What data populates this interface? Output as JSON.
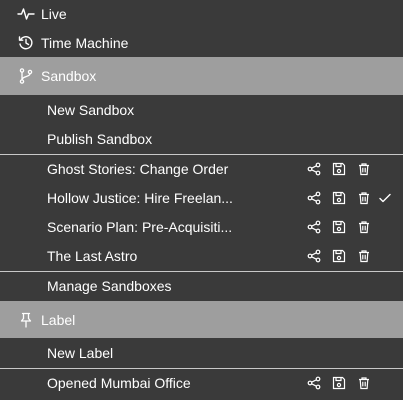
{
  "menu": {
    "top_items": [
      {
        "label": "Live",
        "icon": "pulse-icon"
      },
      {
        "label": "Time Machine",
        "icon": "history-icon"
      }
    ],
    "sandbox": {
      "header": "Sandbox",
      "icon": "git-branch-icon",
      "actions": [
        "New Sandbox",
        "Publish Sandbox"
      ],
      "items": [
        {
          "label": "Ghost Stories: Change Order",
          "active": false
        },
        {
          "label": "Hollow Justice: Hire Freelan...",
          "active": true
        },
        {
          "label": "Scenario Plan: Pre-Acquisiti...",
          "active": false
        },
        {
          "label": "The Last Astro",
          "active": false
        }
      ],
      "manage": "Manage Sandboxes"
    },
    "label": {
      "header": "Label",
      "icon": "pin-icon",
      "actions": [
        "New Label"
      ],
      "items": [
        {
          "label": "Opened Mumbai Office"
        }
      ]
    }
  },
  "colors": {
    "background": "#3a3a3a",
    "section_header": "#9e9e9e",
    "divider": "#c8c8c8",
    "text": "#ffffff"
  }
}
